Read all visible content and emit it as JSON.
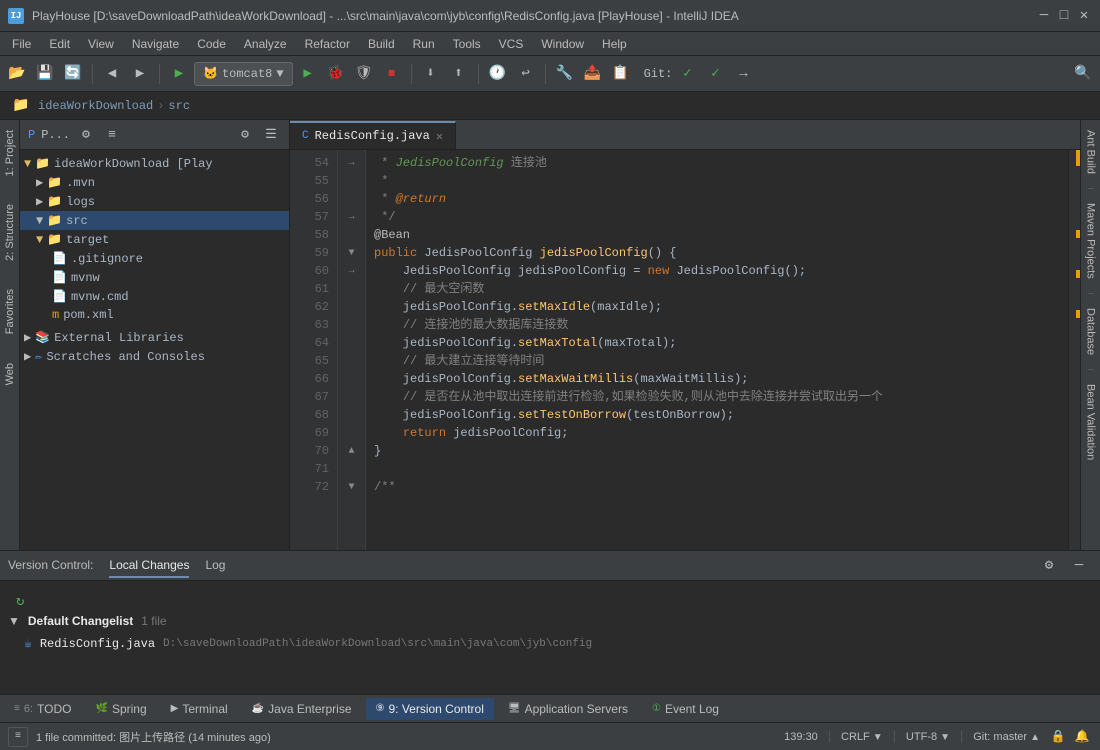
{
  "titleBar": {
    "title": "PlayHouse [D:\\saveDownloadPath\\ideaWorkDownload] - ...\\src\\main\\java\\com\\jyb\\config\\RedisConfig.java [PlayHouse] - IntelliJ IDEA",
    "appLabel": "IJ"
  },
  "menuBar": {
    "items": [
      "File",
      "Edit",
      "View",
      "Navigate",
      "Code",
      "Analyze",
      "Refactor",
      "Build",
      "Run",
      "Tools",
      "VCS",
      "Window",
      "Help"
    ]
  },
  "toolbar": {
    "tomcat": "tomcat8",
    "gitLabel": "Git:"
  },
  "breadcrumb": {
    "items": [
      "ideaWorkDownload",
      "src"
    ]
  },
  "projectPanel": {
    "title": "P...",
    "tree": [
      {
        "level": 0,
        "label": "ideaWorkDownload [Play",
        "type": "folder",
        "expanded": true
      },
      {
        "level": 1,
        "label": ".mvn",
        "type": "folder",
        "expanded": false
      },
      {
        "level": 1,
        "label": "logs",
        "type": "folder",
        "expanded": false
      },
      {
        "level": 1,
        "label": "src",
        "type": "folder",
        "expanded": true,
        "selected": true
      },
      {
        "level": 1,
        "label": "target",
        "type": "folder",
        "expanded": true
      },
      {
        "level": 2,
        "label": ".gitignore",
        "type": "file"
      },
      {
        "level": 2,
        "label": "mvnw",
        "type": "file"
      },
      {
        "level": 2,
        "label": "mvnw.cmd",
        "type": "file"
      },
      {
        "level": 2,
        "label": "pom.xml",
        "type": "xml"
      },
      {
        "level": 0,
        "label": "External Libraries",
        "type": "folder",
        "expanded": false
      },
      {
        "level": 0,
        "label": "Scratches and Consoles",
        "type": "folder",
        "expanded": false
      }
    ]
  },
  "sideTabs": {
    "left": [
      "1: Project",
      "2: Structure",
      "Favorites"
    ],
    "right": [
      "Ant Build",
      "Maven Projects",
      "Database",
      "Bean Validation"
    ]
  },
  "editorTabs": [
    {
      "label": "RedisConfig.java",
      "active": true,
      "closeable": true
    }
  ],
  "codeEditor": {
    "lineStart": 54,
    "lines": [
      {
        "num": 54,
        "content": " * JedisPoolConfig 连接池"
      },
      {
        "num": 55,
        "content": " *"
      },
      {
        "num": 56,
        "content": " * @return"
      },
      {
        "num": 57,
        "content": " */"
      },
      {
        "num": 58,
        "content": "@Bean"
      },
      {
        "num": 59,
        "content": "public JedisPoolConfig jedisPoolConfig() {"
      },
      {
        "num": 60,
        "content": "    JedisPoolConfig jedisPoolConfig = new JedisPoolConfig();"
      },
      {
        "num": 61,
        "content": "    // 最大空闲数"
      },
      {
        "num": 62,
        "content": "    jedisPoolConfig.setMaxIdle(maxIdle);"
      },
      {
        "num": 63,
        "content": "    // 连接池的最大数据库连接数"
      },
      {
        "num": 64,
        "content": "    jedisPoolConfig.setMaxTotal(maxTotal);"
      },
      {
        "num": 65,
        "content": "    // 最大建立连接等待时间"
      },
      {
        "num": 66,
        "content": "    jedisPoolConfig.setMaxWaitMillis(maxWaitMillis);"
      },
      {
        "num": 67,
        "content": "    // 是否在从池中取出连接前进行检验,如果检验失败,则从池中去除连接并尝试取出另一个"
      },
      {
        "num": 68,
        "content": "    jedisPoolConfig.setTestOnBorrow(testOnBorrow);"
      },
      {
        "num": 69,
        "content": "    return jedisPoolConfig;"
      },
      {
        "num": 70,
        "content": "}"
      },
      {
        "num": 71,
        "content": ""
      },
      {
        "num": 72,
        "content": "/**"
      }
    ]
  },
  "bottomTabs": {
    "vcTabs": [
      "Version Control:",
      "Local Changes",
      "Log"
    ],
    "changelist": {
      "name": "Default Changelist",
      "count": "1 file",
      "files": [
        {
          "name": "RedisConfig.java",
          "path": "D:\\saveDownloadPath\\ideaWorkDownload\\src\\main\\java\\com\\jyb\\config"
        }
      ]
    }
  },
  "statusBarTabs": [
    {
      "number": "6",
      "label": "TODO"
    },
    {
      "number": "",
      "label": "Spring"
    },
    {
      "number": "",
      "label": "Terminal"
    },
    {
      "number": "",
      "label": "Java Enterprise"
    },
    {
      "number": "9",
      "label": "Version Control",
      "active": true
    },
    {
      "number": "",
      "label": "Application Servers"
    },
    {
      "number": "1",
      "label": "Event Log"
    }
  ],
  "statusBar": {
    "position": "139:30",
    "lineEnding": "CRLF",
    "encoding": "UTF-8",
    "git": "Git: master",
    "message": "1 file committed: 图片上传路径 (14 minutes ago)"
  }
}
